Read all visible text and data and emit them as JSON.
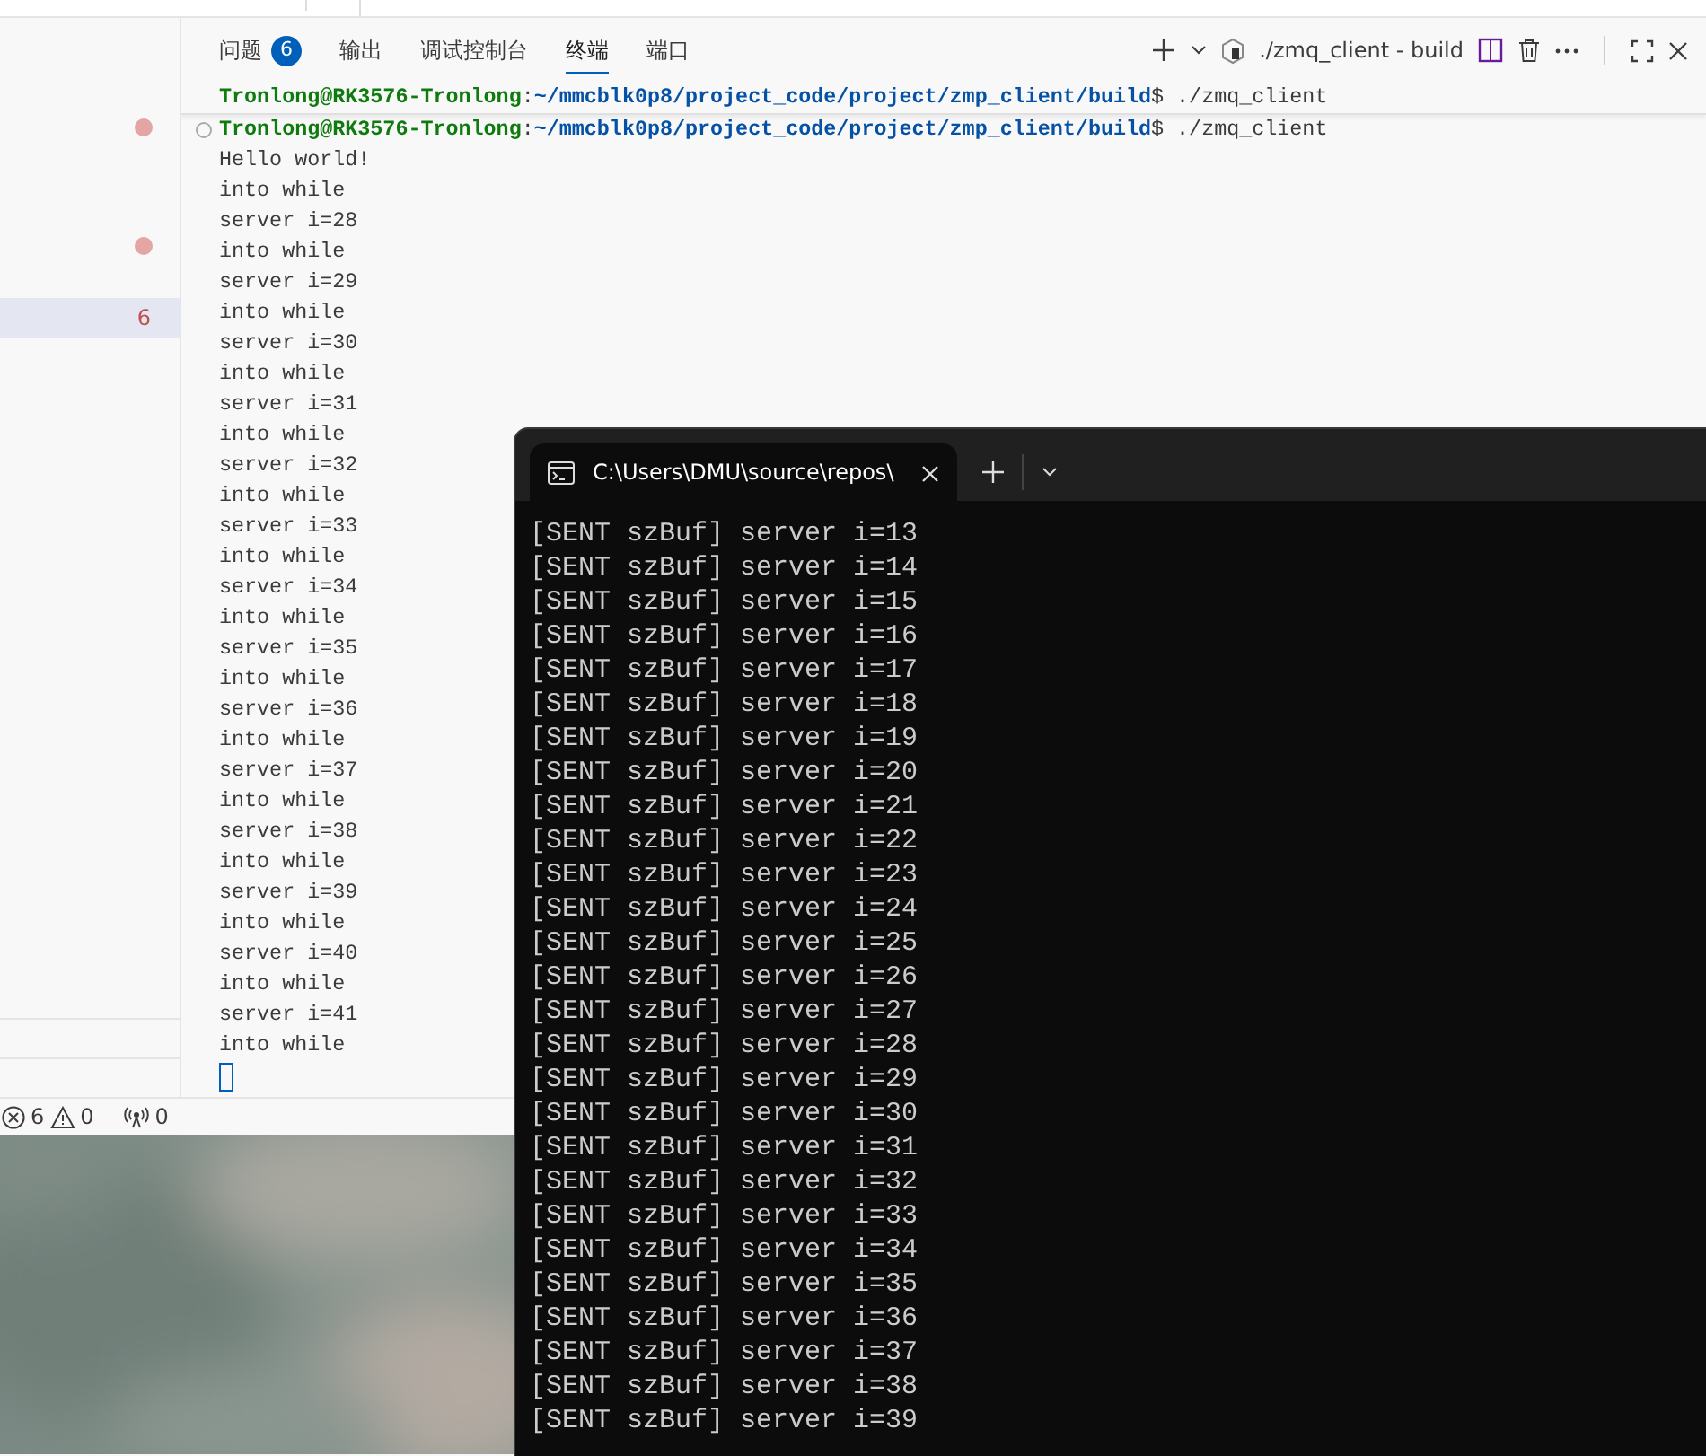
{
  "sidebar": {
    "count": "6",
    "selected": true
  },
  "panel": {
    "tabs": [
      {
        "label": "问题",
        "badge": "6",
        "selected": false
      },
      {
        "label": "输出",
        "selected": false
      },
      {
        "label": "调试控制台",
        "selected": false
      },
      {
        "label": "终端",
        "selected": true
      },
      {
        "label": "端口",
        "selected": false
      }
    ],
    "terminal_name": "./zmq_client - build",
    "prompts": [
      {
        "user": "Tronlong@RK3576-Tronlong",
        "separator": ":",
        "path": "~/mmcblk0p8/project_code/project/zmp_client/build",
        "command": "$ ./zmq_client",
        "sticky": true
      },
      {
        "user": "Tronlong@RK3576-Tronlong",
        "separator": ":",
        "path": "~/mmcblk0p8/project_code/project/zmp_client/build",
        "command": "$ ./zmq_client",
        "sticky": false
      }
    ],
    "output": [
      "Hello world!",
      "into while",
      "server i=28",
      "into while",
      "server i=29",
      "into while",
      "server i=30",
      "into while",
      "server i=31",
      "into while",
      "server i=32",
      "into while",
      "server i=33",
      "into while",
      "server i=34",
      "into while",
      "server i=35",
      "into while",
      "server i=36",
      "into while",
      "server i=37",
      "into while",
      "server i=38",
      "into while",
      "server i=39",
      "into while",
      "server i=40",
      "into while",
      "server i=41",
      "into while"
    ]
  },
  "status_bar": {
    "errors": "6",
    "warnings": "0",
    "ports": "0"
  },
  "windows_terminal": {
    "tab_title": "C:\\Users\\DMU\\source\\repos\\",
    "lines": [
      "[SENT szBuf] server i=13",
      "[SENT szBuf] server i=14",
      "[SENT szBuf] server i=15",
      "[SENT szBuf] server i=16",
      "[SENT szBuf] server i=17",
      "[SENT szBuf] server i=18",
      "[SENT szBuf] server i=19",
      "[SENT szBuf] server i=20",
      "[SENT szBuf] server i=21",
      "[SENT szBuf] server i=22",
      "[SENT szBuf] server i=23",
      "[SENT szBuf] server i=24",
      "[SENT szBuf] server i=25",
      "[SENT szBuf] server i=26",
      "[SENT szBuf] server i=27",
      "[SENT szBuf] server i=28",
      "[SENT szBuf] server i=29",
      "[SENT szBuf] server i=30",
      "[SENT szBuf] server i=31",
      "[SENT szBuf] server i=32",
      "[SENT szBuf] server i=33",
      "[SENT szBuf] server i=34",
      "[SENT szBuf] server i=35",
      "[SENT szBuf] server i=36",
      "[SENT szBuf] server i=37",
      "[SENT szBuf] server i=38",
      "[SENT szBuf] server i=39"
    ]
  }
}
